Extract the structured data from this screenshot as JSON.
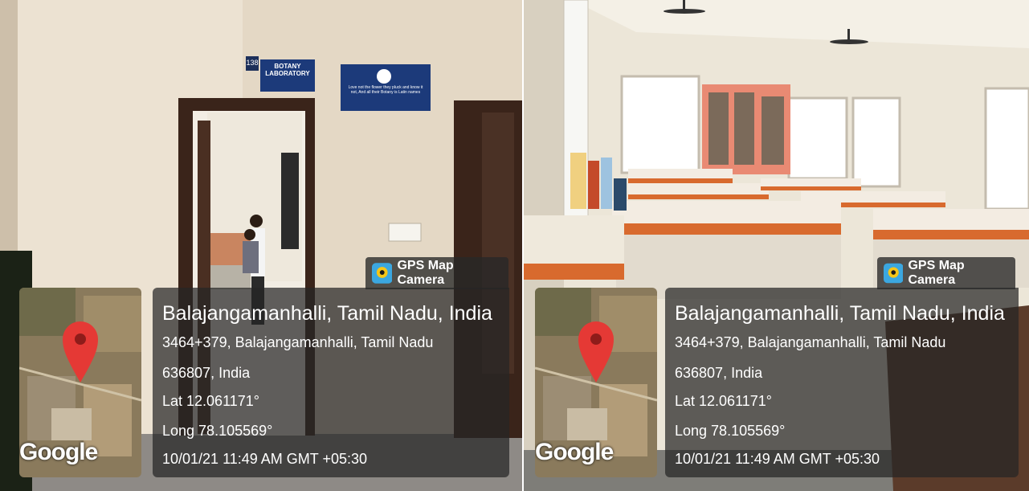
{
  "left_photo": {
    "door_sign_number": "138",
    "door_sign": "BOTANY\nLABORATORY",
    "wall_poster_quote": "Love not the flower they pluck and know it not, And all their Botany is Latin names",
    "gps_badge": "GPS Map Camera",
    "map_logo": "Google",
    "location_title": "Balajangamanhalli, Tamil Nadu, India",
    "address_line1": "3464+379, Balajangamanhalli, Tamil Nadu",
    "address_line2": "636807, India",
    "latitude": "Lat 12.061171°",
    "longitude": "Long 78.105569°",
    "timestamp": "10/01/21 11:49 AM GMT +05:30"
  },
  "right_photo": {
    "gps_badge": "GPS Map Camera",
    "map_logo": "Google",
    "location_title": "Balajangamanhalli, Tamil Nadu, India",
    "address_line1": "3464+379, Balajangamanhalli, Tamil Nadu",
    "address_line2": "636807, India",
    "latitude": "Lat 12.061171°",
    "longitude": "Long 78.105569°",
    "timestamp": "10/01/21 11:49 AM GMT +05:30"
  },
  "colors": {
    "wall": "#e8dccb",
    "door_frame": "#3a241a",
    "sign_blue": "#1c3a7a",
    "cabinet_salmon": "#e98a73",
    "bench_orange": "#d86a2e",
    "map_pin": "#e53935",
    "overlay": "#262626"
  },
  "icons": [
    "map-pin-icon",
    "gps-camera-logo-icon",
    "ceiling-fan-icon"
  ]
}
